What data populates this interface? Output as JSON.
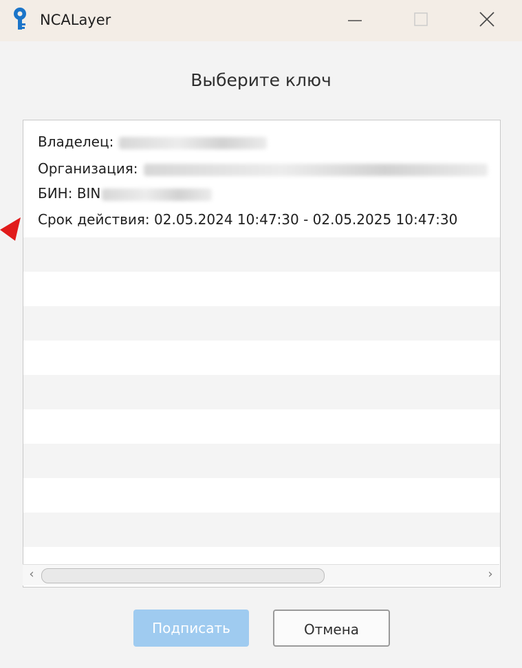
{
  "window": {
    "title": "NCALayer",
    "controls": {
      "minimize_icon": "minimize-icon",
      "maximize_icon": "maximize-icon",
      "close_icon": "close-icon"
    }
  },
  "dialog": {
    "title": "Выберите ключ"
  },
  "key_list": {
    "items": [
      {
        "owner_label": "Владелец:",
        "organization_label": "Организация:",
        "bin_label": "БИН: BIN",
        "validity_label": "Срок действия:",
        "validity_value": "02.05.2024 10:47:30 - 02.05.2025 10:47:30"
      }
    ]
  },
  "scrollbar": {
    "left_arrow": "‹",
    "right_arrow": "›"
  },
  "buttons": {
    "sign_label": "Подписать",
    "cancel_label": "Отмена"
  },
  "colors": {
    "accent": "#9fcbf0",
    "title_bar": "#f3ede6",
    "annotation_arrow": "#e11b1b"
  }
}
